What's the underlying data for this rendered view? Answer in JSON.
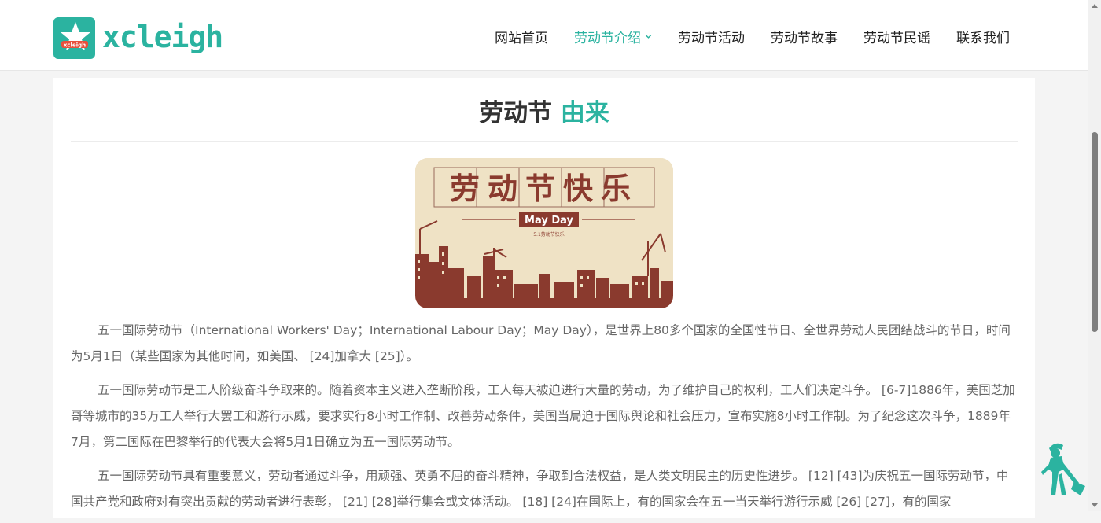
{
  "brand": {
    "logo_text": "xcleigh",
    "logo_badge_text": "xcleigh"
  },
  "nav": {
    "items": [
      {
        "label": "网站首页",
        "active": false,
        "has_dropdown": false
      },
      {
        "label": "劳动节介绍",
        "active": true,
        "has_dropdown": true
      },
      {
        "label": "劳动节活动",
        "active": false,
        "has_dropdown": false
      },
      {
        "label": "劳动节故事",
        "active": false,
        "has_dropdown": false
      },
      {
        "label": "劳动节民谣",
        "active": false,
        "has_dropdown": false
      },
      {
        "label": "联系我们",
        "active": false,
        "has_dropdown": false
      }
    ]
  },
  "article": {
    "title_main": "劳动节",
    "title_accent": "由来",
    "banner": {
      "heading": "劳动节快乐",
      "subheading": "May Day",
      "caption": "5.1劳动节快乐"
    },
    "paragraphs": [
      "五一国际劳动节（International Workers' Day；International Labour Day；May Day），是世界上80多个国家的全国性节日、全世界劳动人民团结战斗的节日，时间为5月1日（某些国家为其他时间，如美国、 [24]加拿大 [25]）。",
      "五一国际劳动节是工人阶级奋斗争取来的。随着资本主义进入垄断阶段，工人每天被迫进行大量的劳动，为了维护自己的权利，工人们决定斗争。 [6-7]1886年，美国芝加哥等城市的35万工人举行大罢工和游行示威，要求实行8小时工作制、改善劳动条件，美国当局迫于国际舆论和社会压力，宣布实施8小时工作制。为了纪念这次斗争，1889年7月，第二国际在巴黎举行的代表大会将5月1日确立为五一国际劳动节。",
      "五一国际劳动节具有重要意义，劳动者通过斗争，用顽强、英勇不屈的奋斗精神，争取到合法权益，是人类文明民主的历史性进步。 [12] [43]为庆祝五一国际劳动节，中国共产党和政府对有突出贡献的劳动者进行表彰， [21] [28]举行集会或文体活动。 [18] [24]在国际上，有的国家会在五一当天举行游行示威 [26] [27]，有的国家"
    ]
  },
  "colors": {
    "accent": "#2bb3a0",
    "banner_red": "#8a3a2e",
    "banner_bg": "#efe2c5"
  },
  "icons": {
    "nav_dropdown": "chevron-down-icon",
    "mascot": "worker-shovel-icon"
  }
}
